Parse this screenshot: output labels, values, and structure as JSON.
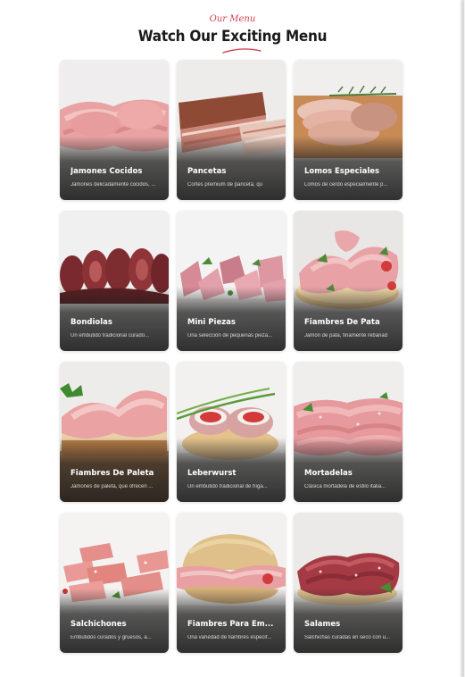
{
  "header": {
    "eyebrow": "Our Menu",
    "title": "Watch Our Exciting Menu",
    "accent_color": "#d2404f"
  },
  "cards": [
    {
      "name": "Jamones Cocidos",
      "description": "Jamones delicadamente cocidos, ...",
      "image": "sliced-ham"
    },
    {
      "name": "Pancetas",
      "description": "Cortes premium de panceta, qu",
      "image": "bacon-slab"
    },
    {
      "name": "Lomos Especiales",
      "description": "Lomos de cerdo especialmente p...",
      "image": "pork-loin-slices"
    },
    {
      "name": "Bondiolas",
      "description": "Un embutido tradicional curado...",
      "image": "cured-coppa"
    },
    {
      "name": "Mini Piezas",
      "description": "Una selección de pequeñas pieza...",
      "image": "mini-cuts"
    },
    {
      "name": "Fiambres De Pata",
      "description": "Jamón de pata, finamente rebanad",
      "image": "ham-sandwich"
    },
    {
      "name": "Fiambres De Paleta",
      "description": "Jamones de paleta, que ofrecen ...",
      "image": "shoulder-ham-bread"
    },
    {
      "name": "Leberwurst",
      "description": "Un embutido tradicional de híga...",
      "image": "liver-sausage"
    },
    {
      "name": "Mortadelas",
      "description": "Clásica mortadela de estilo italia...",
      "image": "mortadella"
    },
    {
      "name": "Salchichones",
      "description": "Embutidos curados y gruesos, a...",
      "image": "sausage-cubes"
    },
    {
      "name": "Fiambres Para Em...",
      "description": "Una variedad de fiambres especif...",
      "image": "cold-cut-bun"
    },
    {
      "name": "Salames",
      "description": "Salchichas curadas en seco con u...",
      "image": "salami"
    }
  ]
}
